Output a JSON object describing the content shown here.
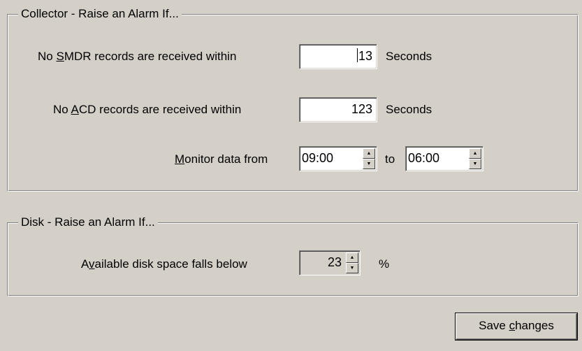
{
  "collector": {
    "title": "Collector - Raise an Alarm If...",
    "smdr": {
      "label_pre": "No ",
      "label_accel": "S",
      "label_post": "MDR records are received within",
      "value": "13",
      "unit": "Seconds"
    },
    "acd": {
      "label_pre": "No ",
      "label_accel": "A",
      "label_post": "CD records are received within",
      "value": "123",
      "unit": "Seconds"
    },
    "monitor": {
      "label_accel": "M",
      "label_post": "onitor data from",
      "from_value": "09:00",
      "to_label": "to",
      "to_value": "06:00"
    }
  },
  "disk": {
    "title": "Disk - Raise an Alarm If...",
    "space": {
      "label_pre": "A",
      "label_accel": "v",
      "label_post": "ailable disk space falls below",
      "value": "23",
      "unit": "%"
    }
  },
  "save_button": {
    "label_pre": "Save ",
    "label_accel": "c",
    "label_post": "hanges"
  },
  "icons": {
    "spin_up": "arrow-up-icon",
    "spin_down": "arrow-down-icon"
  }
}
